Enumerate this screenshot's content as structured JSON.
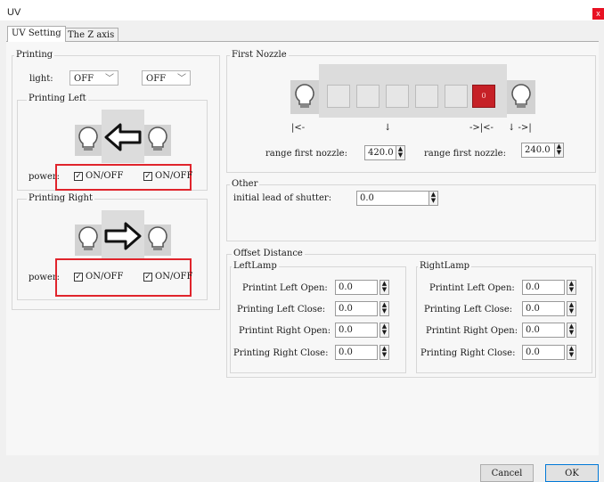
{
  "window": {
    "title": "UV",
    "close_glyph": "x"
  },
  "tabs": [
    {
      "label": "UV Setting",
      "active": true
    },
    {
      "label": "The Z axis",
      "active": false
    }
  ],
  "printing": {
    "title": "Printing",
    "light_label": "light:",
    "light_values": [
      "OFF",
      "OFF"
    ],
    "left": {
      "title": "Printing Left",
      "power_label": "power:",
      "checks": [
        "ON/OFF",
        "ON/OFF"
      ]
    },
    "right": {
      "title": "Printing Right",
      "power_label": "power:",
      "checks": [
        "ON/OFF",
        "ON/OFF"
      ]
    }
  },
  "first_nozzle": {
    "title": "First Nozzle",
    "active_slot_glyph": "0",
    "markers": [
      "|<-",
      "↓",
      "->|<-",
      "↓ ->|"
    ],
    "range1_label": "range first nozzle:",
    "range1_value": "420.0",
    "range2_label": "range first nozzle:",
    "range2_value": "240.0"
  },
  "other": {
    "title": "Other",
    "lead_label": "initial lead of shutter:",
    "lead_value": "0.0"
  },
  "offset": {
    "title": "Offset Distance",
    "left": {
      "title": "LeftLamp",
      "rows": [
        {
          "label": "Printint Left Open:",
          "value": "0.0"
        },
        {
          "label": "Printing Left Close:",
          "value": "0.0"
        },
        {
          "label": "Printint Right Open:",
          "value": "0.0"
        },
        {
          "label": "Printing Right Close:",
          "value": "0.0"
        }
      ]
    },
    "right": {
      "title": "RightLamp",
      "rows": [
        {
          "label": "Printint Left Open:",
          "value": "0.0"
        },
        {
          "label": "Printing Left Close:",
          "value": "0.0"
        },
        {
          "label": "Printint Right Open:",
          "value": "0.0"
        },
        {
          "label": "Printing Right Close:",
          "value": "0.0"
        }
      ]
    }
  },
  "footer": {
    "cancel": "Cancel",
    "ok": "OK"
  },
  "colors": {
    "accent": "#0078d7",
    "highlight": "#e0242c",
    "active_slot": "#c62127"
  }
}
